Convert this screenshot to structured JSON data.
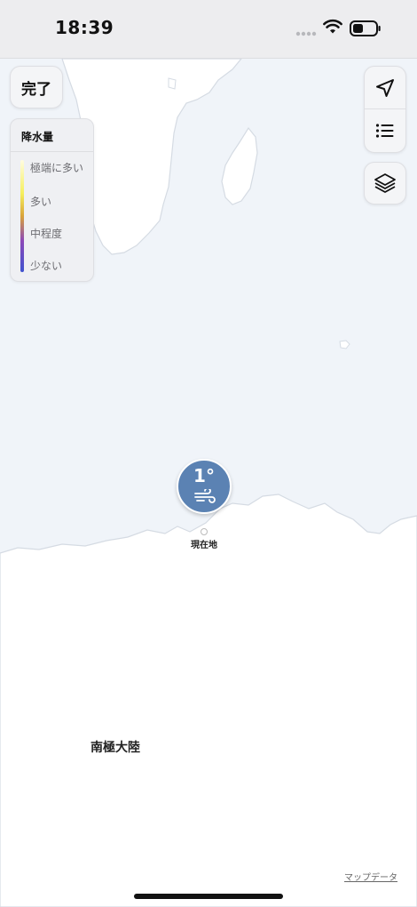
{
  "status_bar": {
    "time": "18:39",
    "signal_icon": "cellular-signal-icon",
    "wifi_icon": "wifi-icon",
    "battery_icon": "battery-icon"
  },
  "toolbar": {
    "done_label": "完了",
    "location_icon": "location-arrow-icon",
    "list_icon": "list-icon",
    "layers_icon": "layers-icon"
  },
  "legend": {
    "title": "降水量",
    "levels": [
      "極端に多い",
      "多い",
      "中程度",
      "少ない"
    ],
    "gradient_colors": [
      "#fffce0",
      "#f5ef5d",
      "#d9a33a",
      "#8d49b8",
      "#3f53cf"
    ]
  },
  "location_pin": {
    "temperature": "1°",
    "condition_icon": "wind-icon",
    "label": "現在地",
    "color": "#5b82b3"
  },
  "map": {
    "region_label": "南極大陸",
    "credit": "マップデータ",
    "ocean_color": "#f0f4f9",
    "land_color": "#ffffff"
  }
}
